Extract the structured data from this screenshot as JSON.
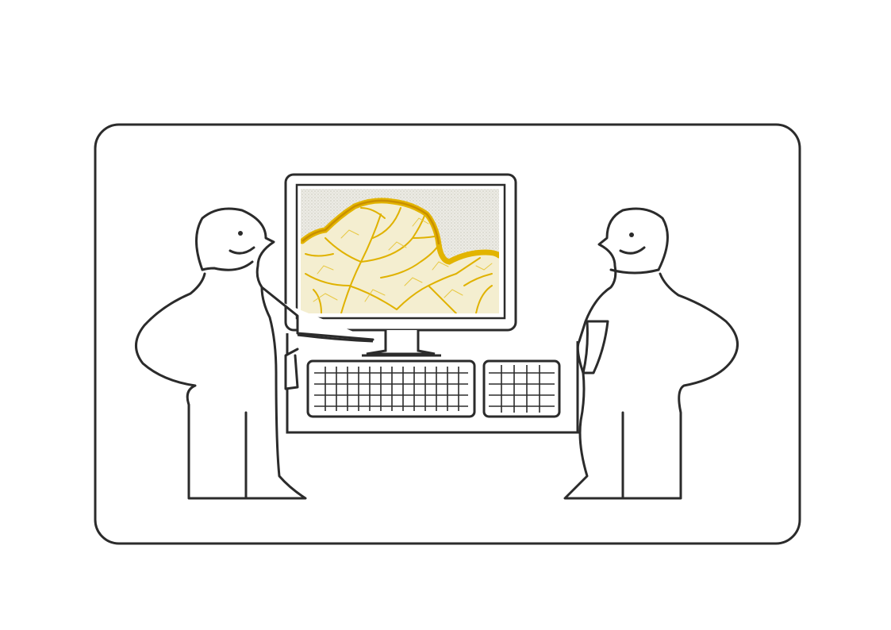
{
  "scene": {
    "frame": "rounded-rectangle-panel",
    "figures": [
      "person-left",
      "person-right"
    ],
    "objects": [
      "computer-monitor",
      "keyboard",
      "numeric-keypad",
      "desk"
    ],
    "screen_content": "yellow-branching-network-image",
    "colors": {
      "background": "#ffffff",
      "line": "#2b2b2b",
      "screen_bg": "#e9e9e3",
      "network": "#e2b400",
      "network_dark": "#c98f00"
    }
  }
}
